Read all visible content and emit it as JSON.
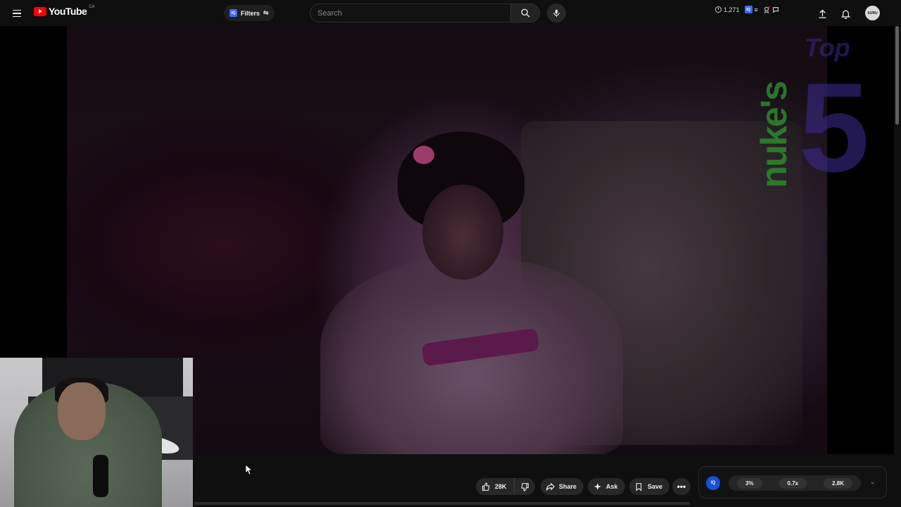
{
  "header": {
    "logo_text": "YouTube",
    "country_code": "CA",
    "filters_label": "Filters",
    "filters_badge": "IQ",
    "search": {
      "placeholder": "Search"
    },
    "watch_count": "1,271",
    "ext_badge": "IQ",
    "avatar_text": "SURU"
  },
  "video": {
    "overlay_channel": "nuke's",
    "overlay_top": "Top",
    "overlay_number": "5"
  },
  "actions": {
    "like_count": "28K",
    "share_label": "Share",
    "ask_label": "Ask",
    "save_label": "Save",
    "more_label": "•••"
  },
  "stats": {
    "badge": "IQ",
    "percent": "3%",
    "ratio": "0.7x",
    "count": "2.8K"
  },
  "colors": {
    "background": "#0f0f0f",
    "brand_red": "#ff0000",
    "pill": "#272727",
    "iq_blue": "#1d4ed8"
  }
}
